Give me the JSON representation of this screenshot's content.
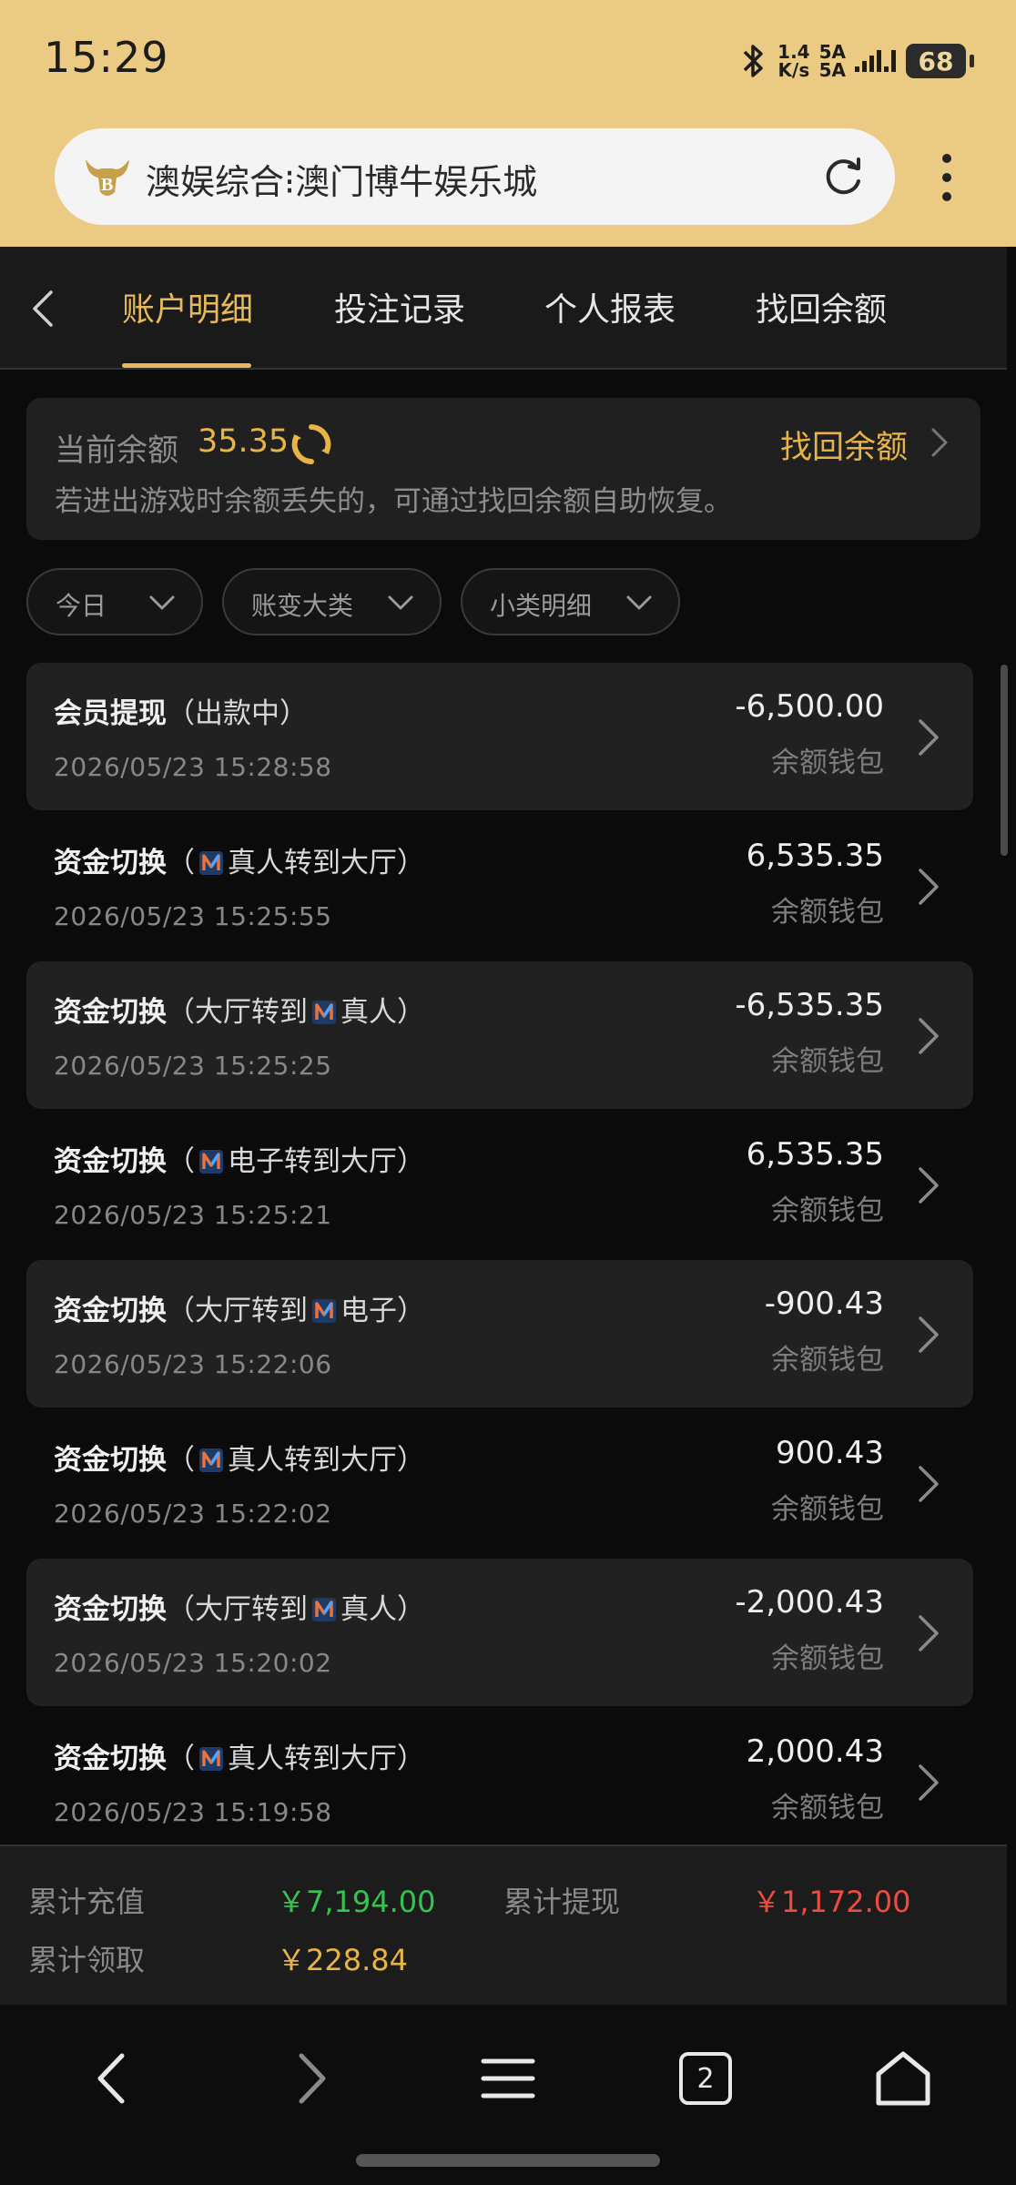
{
  "status_bar": {
    "time": "15:29",
    "speed_value": "1.4",
    "speed_unit": "K/s",
    "net_top": "5A",
    "net_bottom": "5A",
    "battery": "68"
  },
  "browser": {
    "address_text": "澳娱综合⁝澳门博牛娱乐城",
    "tab_count": "2"
  },
  "tabs": [
    {
      "label": "账户明细",
      "active": true
    },
    {
      "label": "投注记录",
      "active": false
    },
    {
      "label": "个人报表",
      "active": false
    },
    {
      "label": "找回余额",
      "active": false
    }
  ],
  "balance": {
    "label": "当前余额",
    "value": "35.35",
    "recover_label": "找回余额",
    "hint": "若进出游戏时余额丢失的，可通过找回余额自助恢复。"
  },
  "filters": {
    "date": "今日",
    "category": "账变大类",
    "subcategory": "小类明细"
  },
  "records": [
    {
      "title": "会员提现",
      "detail_a": "出款中",
      "brand": "",
      "detail_b": "",
      "time": "2026/05/23 15:28:58",
      "amount": "-6,500.00",
      "wallet": "余额钱包"
    },
    {
      "title": "资金切换",
      "detail_a": "",
      "brand": "N",
      "detail_b": "真人转到大厅",
      "time": "2026/05/23 15:25:55",
      "amount": "6,535.35",
      "wallet": "余额钱包"
    },
    {
      "title": "资金切换",
      "detail_a": "大厅转到",
      "brand": "N",
      "detail_b": "真人",
      "time": "2026/05/23 15:25:25",
      "amount": "-6,535.35",
      "wallet": "余额钱包"
    },
    {
      "title": "资金切换",
      "detail_a": "",
      "brand": "N",
      "detail_b": "电子转到大厅",
      "time": "2026/05/23 15:25:21",
      "amount": "6,535.35",
      "wallet": "余额钱包"
    },
    {
      "title": "资金切换",
      "detail_a": "大厅转到",
      "brand": "N",
      "detail_b": "电子",
      "time": "2026/05/23 15:22:06",
      "amount": "-900.43",
      "wallet": "余额钱包"
    },
    {
      "title": "资金切换",
      "detail_a": "",
      "brand": "N",
      "detail_b": "真人转到大厅",
      "time": "2026/05/23 15:22:02",
      "amount": "900.43",
      "wallet": "余额钱包"
    },
    {
      "title": "资金切换",
      "detail_a": "大厅转到",
      "brand": "N",
      "detail_b": "真人",
      "time": "2026/05/23 15:20:02",
      "amount": "-2,000.43",
      "wallet": "余额钱包"
    },
    {
      "title": "资金切换",
      "detail_a": "",
      "brand": "N",
      "detail_b": "真人转到大厅",
      "time": "2026/05/23 15:19:58",
      "amount": "2,000.43",
      "wallet": "余额钱包"
    }
  ],
  "summary": {
    "recharge_label": "累计充值",
    "recharge_value": "￥7,194.00",
    "withdraw_label": "累计提现",
    "withdraw_value": "￥1,172.00",
    "claim_label": "累计领取",
    "claim_value": "￥228.84"
  },
  "colors": {
    "accent_gold": "#e8b447",
    "positive_green": "#33c451",
    "negative_red": "#f04b3f",
    "header_yellow": "#ebcb84"
  },
  "icons": {
    "status": [
      "bluetooth-icon",
      "signal-icon",
      "battery-icon"
    ],
    "browser": [
      "site-logo-icon",
      "reload-icon",
      "more-icon"
    ],
    "nav": [
      "back-icon",
      "forward-icon",
      "menu-icon",
      "tabs-icon",
      "home-icon"
    ]
  }
}
